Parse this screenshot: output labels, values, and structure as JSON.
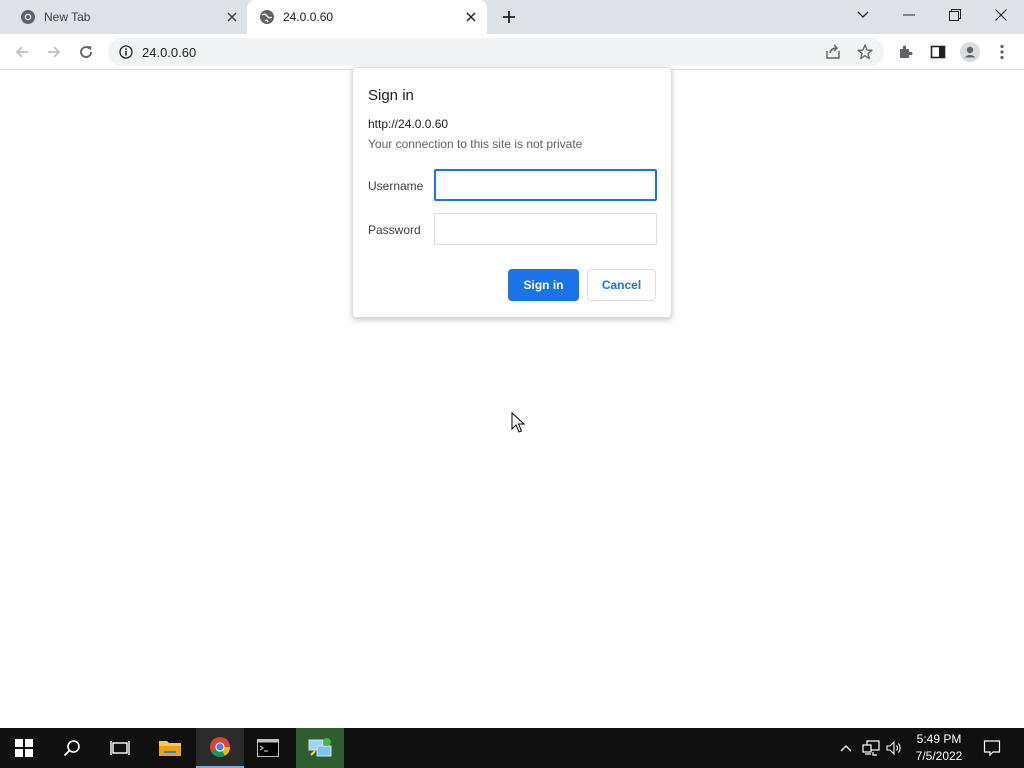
{
  "browser": {
    "tabs": [
      {
        "title": "New Tab",
        "favicon": "chrome-icon",
        "active": false
      },
      {
        "title": "24.0.0.60",
        "favicon": "globe-icon",
        "active": true
      }
    ],
    "address": "24.0.0.60"
  },
  "dialog": {
    "title": "Sign in",
    "origin": "http://24.0.0.60",
    "warning": "Your connection to this site is not private",
    "username_label": "Username",
    "username_value": "",
    "password_label": "Password",
    "password_value": "",
    "sign_in_label": "Sign in",
    "cancel_label": "Cancel"
  },
  "taskbar": {
    "apps": [
      "start-icon",
      "search-icon",
      "task-view-icon",
      "file-explorer-icon",
      "chrome-icon",
      "terminal-icon",
      "network-tool-icon"
    ],
    "clock_time": "5:49 PM",
    "clock_date": "7/5/2022"
  },
  "colors": {
    "accent": "#1a73e8",
    "tabstrip": "#dee1e6",
    "omnibox": "#f1f3f4",
    "taskbar": "#101010"
  }
}
